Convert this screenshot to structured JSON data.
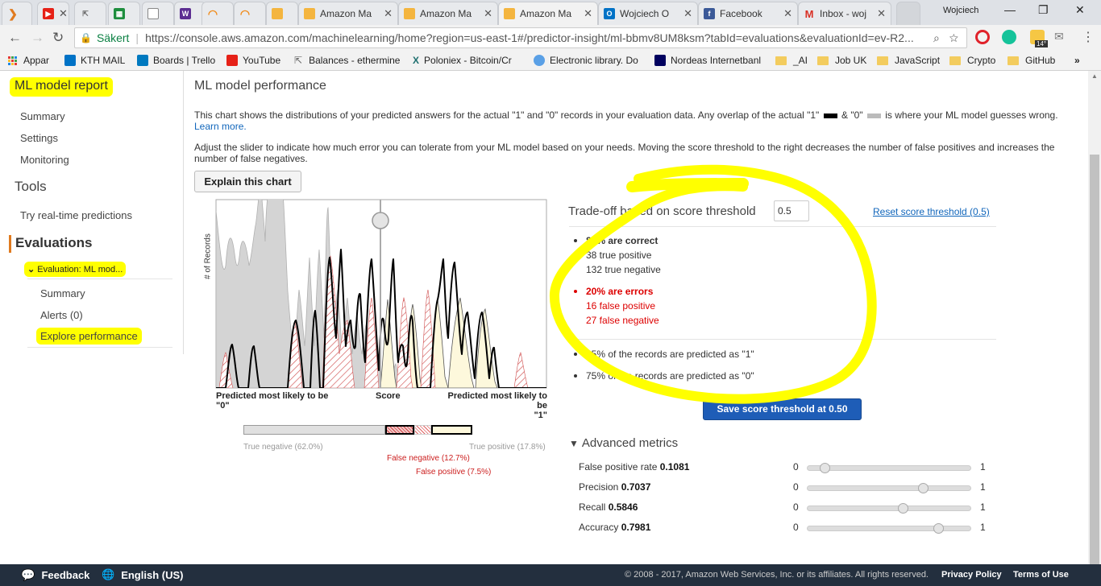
{
  "browser": {
    "tabs": [
      {
        "label": "",
        "icon": "aws-icon"
      },
      {
        "label": "",
        "icon": "youtube-icon"
      },
      {
        "label": "",
        "icon": "ethermine-icon"
      },
      {
        "label": "",
        "icon": "sheet-icon"
      },
      {
        "label": "",
        "icon": "page-icon"
      },
      {
        "label": "",
        "icon": "wo-icon"
      },
      {
        "label": "",
        "icon": "orange-arc-icon"
      },
      {
        "label": "",
        "icon": "orange-arc-icon"
      },
      {
        "label": "",
        "icon": "box-icon"
      },
      {
        "label": "Amazon Ma",
        "icon": "box-icon"
      },
      {
        "label": "Amazon Ma",
        "icon": "box-icon"
      },
      {
        "label": "Amazon Ma",
        "icon": "box-icon"
      },
      {
        "label": "Wojciech O",
        "icon": "outlook-icon"
      },
      {
        "label": "Facebook",
        "icon": "facebook-icon"
      },
      {
        "label": "Inbox - woj",
        "icon": "gmail-icon"
      }
    ],
    "user": "Wojciech",
    "secure_label": "Säkert",
    "url": "https://console.aws.amazon.com/machinelearning/home?region=us-east-1#/predictor-insight/ml-bbmv8UM8ksm?tabId=evaluations&evaluationId=ev-R2...",
    "weather_badge": "14°",
    "bookmarks": [
      {
        "label": "Appar",
        "icon": "apps-icon"
      },
      {
        "label": "KTH MAIL",
        "icon": "outlook-icon"
      },
      {
        "label": "Boards | Trello",
        "icon": "trello-icon"
      },
      {
        "label": "YouTube",
        "icon": "youtube-icon"
      },
      {
        "label": "Balances - ethermine",
        "icon": "ethermine-icon"
      },
      {
        "label": "Poloniex - Bitcoin/Cr",
        "icon": "poloniex-icon"
      },
      {
        "label": "Electronic library. Do",
        "icon": "globe-icon"
      },
      {
        "label": "Nordeas Internetbanl",
        "icon": "bank-icon"
      },
      {
        "label": "_AI",
        "icon": "folder-icon"
      },
      {
        "label": "Job UK",
        "icon": "folder-icon"
      },
      {
        "label": "JavaScript",
        "icon": "folder-icon"
      },
      {
        "label": "Crypto",
        "icon": "folder-icon"
      },
      {
        "label": "GitHub",
        "icon": "folder-icon"
      }
    ],
    "more_bookmarks": "»"
  },
  "sidebar": {
    "title": "ML model report",
    "items": {
      "summary": "Summary",
      "settings": "Settings",
      "monitoring": "Monitoring"
    },
    "tools_heading": "Tools",
    "tools_item": "Try real-time predictions",
    "evaluations_heading": "Evaluations",
    "evaluation_item": "Evaluation: ML mod...",
    "sub_items": {
      "summary": "Summary",
      "alerts": "Alerts (0)",
      "explore": "Explore performance"
    }
  },
  "main": {
    "title": "ML model performance",
    "para1_a": "This chart shows the distributions of your predicted answers for the actual \"1\" and \"0\" records in your evaluation data. Any overlap of the actual \"1\"",
    "para1_amp": "&",
    "para1_b": "\"0\"",
    "para1_c": "is where your ML model guesses wrong.",
    "learn_more": "Learn more.",
    "para2": "Adjust the slider to indicate how much error you can tolerate from your ML model based on your needs. Moving the score threshold to the right decreases the number of false positives and increases the number of false negatives.",
    "explain_button": "Explain this chart",
    "chart": {
      "ylabel": "# of Records",
      "x_left": "Predicted most likely to be \"0\"",
      "x_left_l1": "Predicted most likely to be",
      "x_left_l2": "\"0\"",
      "x_mid": "Score",
      "x_right_l1": "Predicted most likely to be",
      "x_right_l2": "\"1\""
    },
    "distribution": {
      "true_negative": "True negative (62.0%)",
      "false_negative": "False negative (12.7%)",
      "false_positive": "False positive (7.5%)",
      "true_positive": "True positive (17.8%)",
      "fractions": [
        0.62,
        0.127,
        0.075,
        0.178
      ]
    }
  },
  "chart_data": {
    "type": "area",
    "title": "",
    "ylabel": "# of Records",
    "xlabel": "Score",
    "threshold": 0.5,
    "series": [
      {
        "name": "Actual \"0\"",
        "color": "#d4d4d4"
      },
      {
        "name": "Actual \"1\"",
        "color": "#000000"
      }
    ]
  },
  "tradeoff": {
    "title": "Trade-off based on score threshold",
    "threshold_value": "0.5",
    "reset_link": "Reset score threshold (0.5)",
    "correct_pct": "80% are correct",
    "true_positive": "38 true positive",
    "true_negative": "132 true negative",
    "errors_pct": "20% are errors",
    "false_positive": "16 false positive",
    "false_negative": "27 false negative",
    "predicted_1": "25% of the records are predicted as \"1\"",
    "predicted_0": "75% of the records are predicted as \"0\"",
    "save_button": "Save score threshold at 0.50"
  },
  "advanced": {
    "heading": "Advanced metrics",
    "min": "0",
    "max": "1",
    "metrics": [
      {
        "label": "False positive rate",
        "value": "0.1081",
        "fraction": 0.1081
      },
      {
        "label": "Precision",
        "value": "0.7037",
        "fraction": 0.7037
      },
      {
        "label": "Recall",
        "value": "0.5846",
        "fraction": 0.5846
      },
      {
        "label": "Accuracy",
        "value": "0.7981",
        "fraction": 0.7981
      }
    ]
  },
  "footer": {
    "feedback": "Feedback",
    "language": "English (US)",
    "copyright": "© 2008 - 2017, Amazon Web Services, Inc. or its affiliates. All rights reserved.",
    "privacy": "Privacy Policy",
    "terms": "Terms of Use"
  },
  "colors": {
    "highlight": "#ffff00",
    "aws_orange": "#e07b20",
    "save_blue": "#1e5db7",
    "error_red": "#dd0000",
    "footer_bg": "#232f3e"
  }
}
